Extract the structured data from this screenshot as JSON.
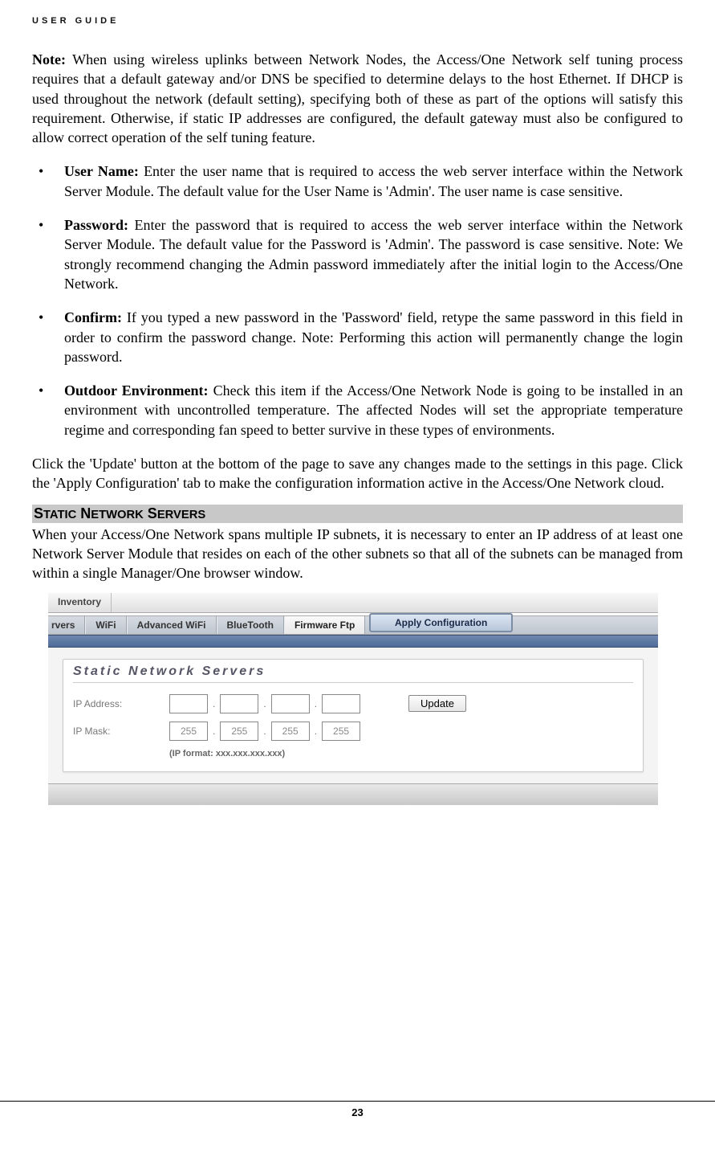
{
  "header": "USER GUIDE",
  "note": {
    "prefix": "Note: ",
    "body": "When using wireless uplinks between Network Nodes, the Access/One Network self tuning process requires that a default gateway and/or DNS be specified to determine delays to the host Ethernet. If DHCP is used throughout the network (default setting), specifying both of these as part of the options will satisfy this requirement. Otherwise, if static IP addresses are configured, the default gateway must also be configured to allow correct operation of the self tuning feature."
  },
  "bullets": [
    {
      "term": "User Name: ",
      "body": "Enter the user name that is required to access the web server interface within the Network Server Module. The default value for the User Name is 'Admin'. The user name is case sensitive."
    },
    {
      "term": "Password: ",
      "body": "Enter the password that is required to access the web server interface within the Network Server Module. The default value for the Password is 'Admin'. The password is case sensitive. Note: We strongly recommend changing the Admin password immediately after the initial login to the Access/One Network."
    },
    {
      "term": "Confirm: ",
      "body": "If you typed a new password in the 'Password' field, retype the same password in this field in order to confirm the password change. Note: Performing this action will permanently change the login password."
    },
    {
      "term": "Outdoor Environment: ",
      "body": "Check this item if the Access/One Network Node is going to be installed in an environment with uncontrolled temperature. The affected Nodes will set the appropriate temperature regime and corresponding fan speed to better survive in these types of environments."
    }
  ],
  "click_para": "Click the 'Update' button at the bottom of the page to save any changes made to the settings in this page. Click the 'Apply Configuration' tab to make the configuration information active in the Access/One Network cloud.",
  "section_heading": "STATIC NETWORK SERVERS",
  "static_para": "When your Access/One Network spans multiple IP subnets, it is necessary to enter an IP address of at least one Network Server Module that resides on each of the other subnets so that all of the subnets can be managed from within a single Manager/One browser window.",
  "screenshot": {
    "top_tabs": {
      "inventory": "Inventory"
    },
    "apply_button": "Apply Configuration",
    "sub_tabs": {
      "rvers": "rvers",
      "wifi": "WiFi",
      "advwifi": "Advanced WiFi",
      "bluetooth": "BlueTooth",
      "firmware": "Firmware Ftp"
    },
    "panel_title": "Static Network Servers",
    "labels": {
      "ipaddress": "IP Address:",
      "ipmask": "IP Mask:"
    },
    "mask_values": [
      "255",
      "255",
      "255",
      "255"
    ],
    "update_button": "Update",
    "hint": "(IP format: xxx.xxx.xxx.xxx)"
  },
  "page_number": "23"
}
